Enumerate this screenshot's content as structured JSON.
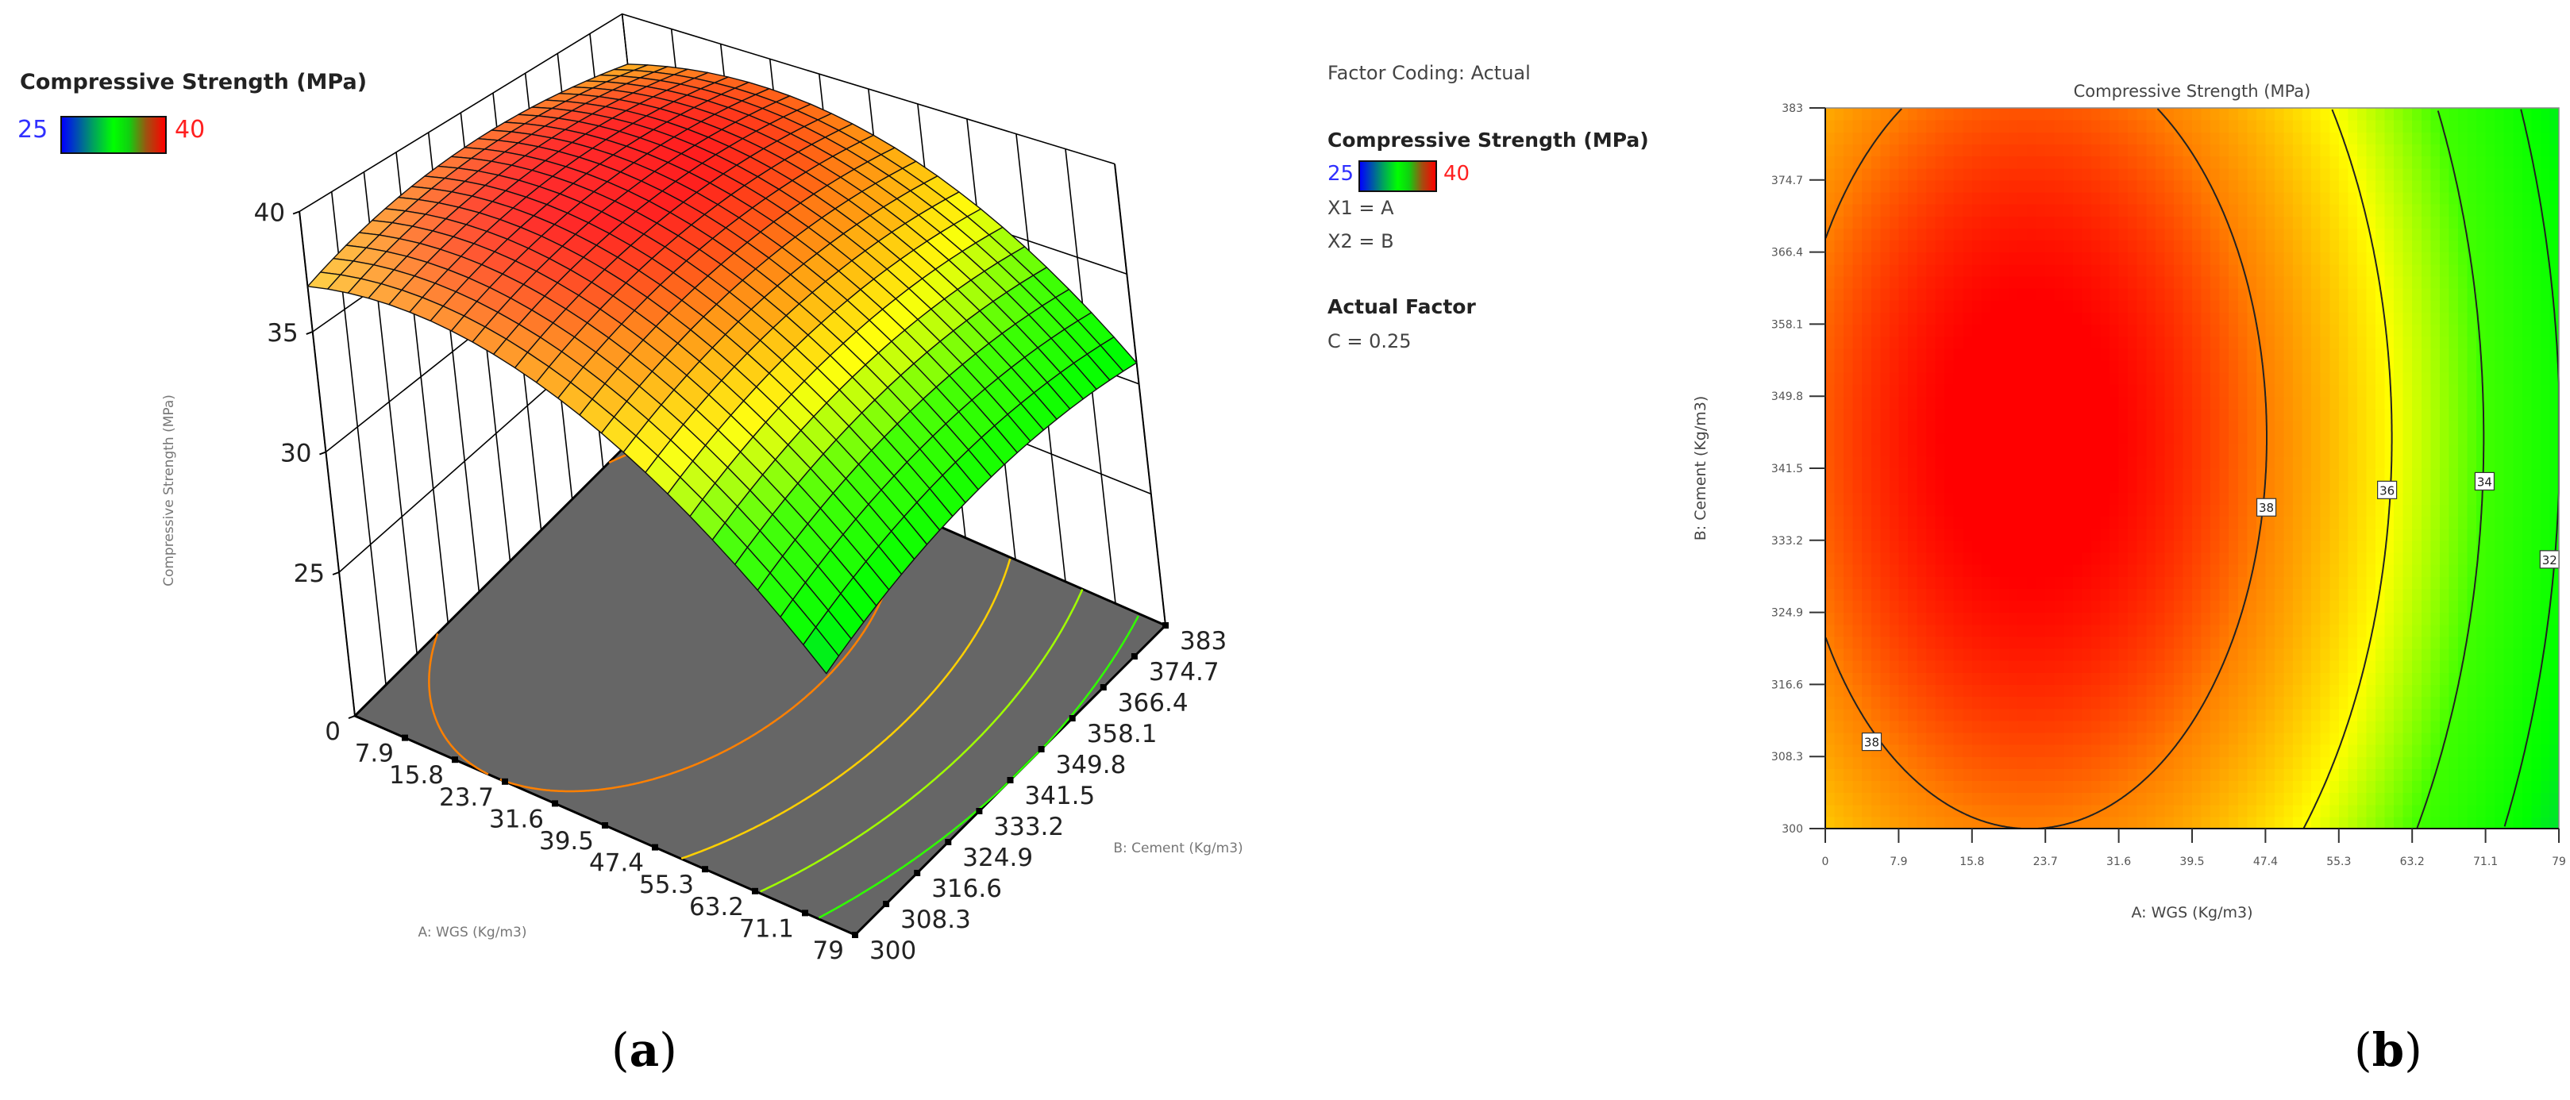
{
  "captions": {
    "a_open": "(",
    "a_letter": "a",
    "a_close": ")",
    "b_open": "(",
    "b_letter": "b",
    "b_close": ")"
  },
  "chart_data": [
    {
      "type": "surface3d",
      "legend": {
        "title": "Compressive Strength  (MPa)",
        "min_label": "25",
        "max_label": "40"
      },
      "xlabel": "A: WGS (Kg/m3)",
      "ylabel": "B: Cement (Kg/m3)",
      "zlabel": "Compressive Strength  (MPa)",
      "x_ticks": [
        "7.9",
        "15.8",
        "23.7",
        "31.6",
        "39.5",
        "47.4",
        "55.3",
        "63.2",
        "71.1",
        "79"
      ],
      "y_ticks": [
        "300",
        "308.3",
        "316.6",
        "324.9",
        "333.2",
        "341.5",
        "349.8",
        "358.1",
        "366.4",
        "374.7",
        "383"
      ],
      "z_ticks": [
        "0",
        "25",
        "30",
        "35",
        "40"
      ],
      "xlim": [
        0,
        79
      ],
      "ylim": [
        300,
        383
      ],
      "zlim": [
        25,
        40
      ],
      "model": {
        "intercept": 39.5,
        "a_center": 22,
        "b_center": 345,
        "a_coef": 0.0023,
        "b_coef": 0.00074
      },
      "floor_contours": [
        {
          "level": 38,
          "color": "#ff8000"
        },
        {
          "level": 36,
          "color": "#ffd000"
        },
        {
          "level": 34,
          "color": "#a0ff00"
        },
        {
          "level": 32,
          "color": "#30ff00"
        },
        {
          "level": 30,
          "color": "#00e000"
        }
      ],
      "colormap": [
        [
          25,
          "#0000ff"
        ],
        [
          29,
          "#00b080"
        ],
        [
          31.5,
          "#00ff00"
        ],
        [
          34,
          "#40ff00"
        ],
        [
          36,
          "#ffff00"
        ],
        [
          38,
          "#ff8000"
        ],
        [
          39.3,
          "#ff0000"
        ]
      ],
      "grid_divisions": 24
    },
    {
      "type": "contour",
      "title": "Compressive Strength  (MPa)",
      "xlabel": "A: WGS (Kg/m3)",
      "ylabel": "B: Cement (Kg/m3)",
      "x_ticks": [
        "0",
        "7.9",
        "15.8",
        "23.7",
        "31.6",
        "39.5",
        "47.4",
        "55.3",
        "63.2",
        "71.1",
        "79"
      ],
      "y_ticks": [
        "300",
        "308.3",
        "316.6",
        "324.9",
        "333.2",
        "341.5",
        "349.8",
        "358.1",
        "366.4",
        "374.7",
        "383"
      ],
      "xlim": [
        0,
        79
      ],
      "ylim": [
        300,
        383
      ],
      "contour_levels": [
        38,
        36,
        34,
        32
      ],
      "contour_labels": [
        {
          "text": "38",
          "a": 47.5,
          "b": 337
        },
        {
          "text": "38",
          "a": 5,
          "b": 310
        },
        {
          "text": "36",
          "a": 60.5,
          "b": 339
        },
        {
          "text": "34",
          "a": 71,
          "b": 340
        },
        {
          "text": "32",
          "a": 78,
          "b": 331
        }
      ],
      "info": {
        "factor_coding": "Factor Coding: Actual",
        "legend_title": "Compressive Strength  (MPa)",
        "min_label": "25",
        "max_label": "40",
        "x1": "X1 = A",
        "x2": "X2 = B",
        "actual_factor_title": "Actual Factor",
        "actual_factor": "C = 0.25"
      }
    }
  ]
}
